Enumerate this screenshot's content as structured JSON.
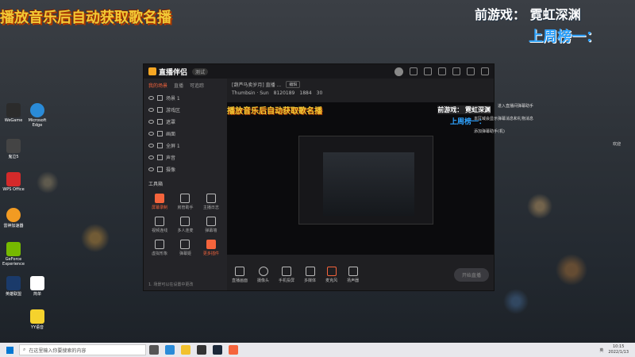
{
  "overlay": {
    "left_banner": "播放音乐后自动获取歌名播",
    "right_line1": "前游戏：  霓虹深渊",
    "right_line2": "上周榜一："
  },
  "desktop_icons": [
    {
      "label": "WeGame",
      "color": "#2b2b2b"
    },
    {
      "label": "Microsoft Edge",
      "color": "#2a8bd8"
    },
    {
      "label": "鬼泣5",
      "color": "#333"
    },
    {
      "label": "WPS Office",
      "color": "#d42a2a"
    },
    {
      "label": "雷神加速器",
      "color": "#f29b22"
    },
    {
      "label": "GeForce Experience",
      "color": "#76b900"
    },
    {
      "label": "英雄联盟",
      "color": "#1a3a6a"
    },
    {
      "label": "简单",
      "color": "#fff"
    },
    {
      "label": "YY语音",
      "color": "#f5d22d"
    }
  ],
  "app": {
    "name": "直播伴侣",
    "version": "测试",
    "tabs": [
      "我的场景",
      "直播",
      "可追踪"
    ],
    "scenes": [
      "场景 1",
      "游戏区",
      "遮罩",
      "画面",
      "全屏 1",
      "声音",
      "摄像"
    ],
    "tools_title": "工具箱",
    "tools": [
      "屏幕录制",
      "房管助手",
      "主播日志",
      "视频连线",
      "多人连麦",
      "弹幕墙",
      "虚拟形象",
      "弹幕姬",
      "更多插件"
    ],
    "room_title": "[葫芦马卖岁月] 直播 ... ",
    "room_tag": "编辑",
    "room_meta": [
      "Thumbsin · Sun",
      "8120189",
      "1884",
      "30"
    ],
    "preview_banner": "播放音乐后自动获取歌名播",
    "preview_right1": "前游戏：  霓虹深渊",
    "preview_right2": "上周榜一：",
    "controls": [
      "直播画面",
      "摄像头",
      "手机投屏",
      "多媒体",
      "麦克风",
      "扬声器"
    ],
    "start_button": "开始直播",
    "status_left": "1. 场景可以在设置中更改"
  },
  "side_panel": {
    "items": [
      "进入直播间弹幕助手",
      "本区域会显示弹幕消息和礼物消息",
      "添加弹幕助手(机)",
      "欢迎"
    ]
  },
  "taskbar": {
    "search_placeholder": "在这里输入你要搜索的内容",
    "time": "10:15",
    "date": "2022/1/13",
    "lang": "英"
  }
}
